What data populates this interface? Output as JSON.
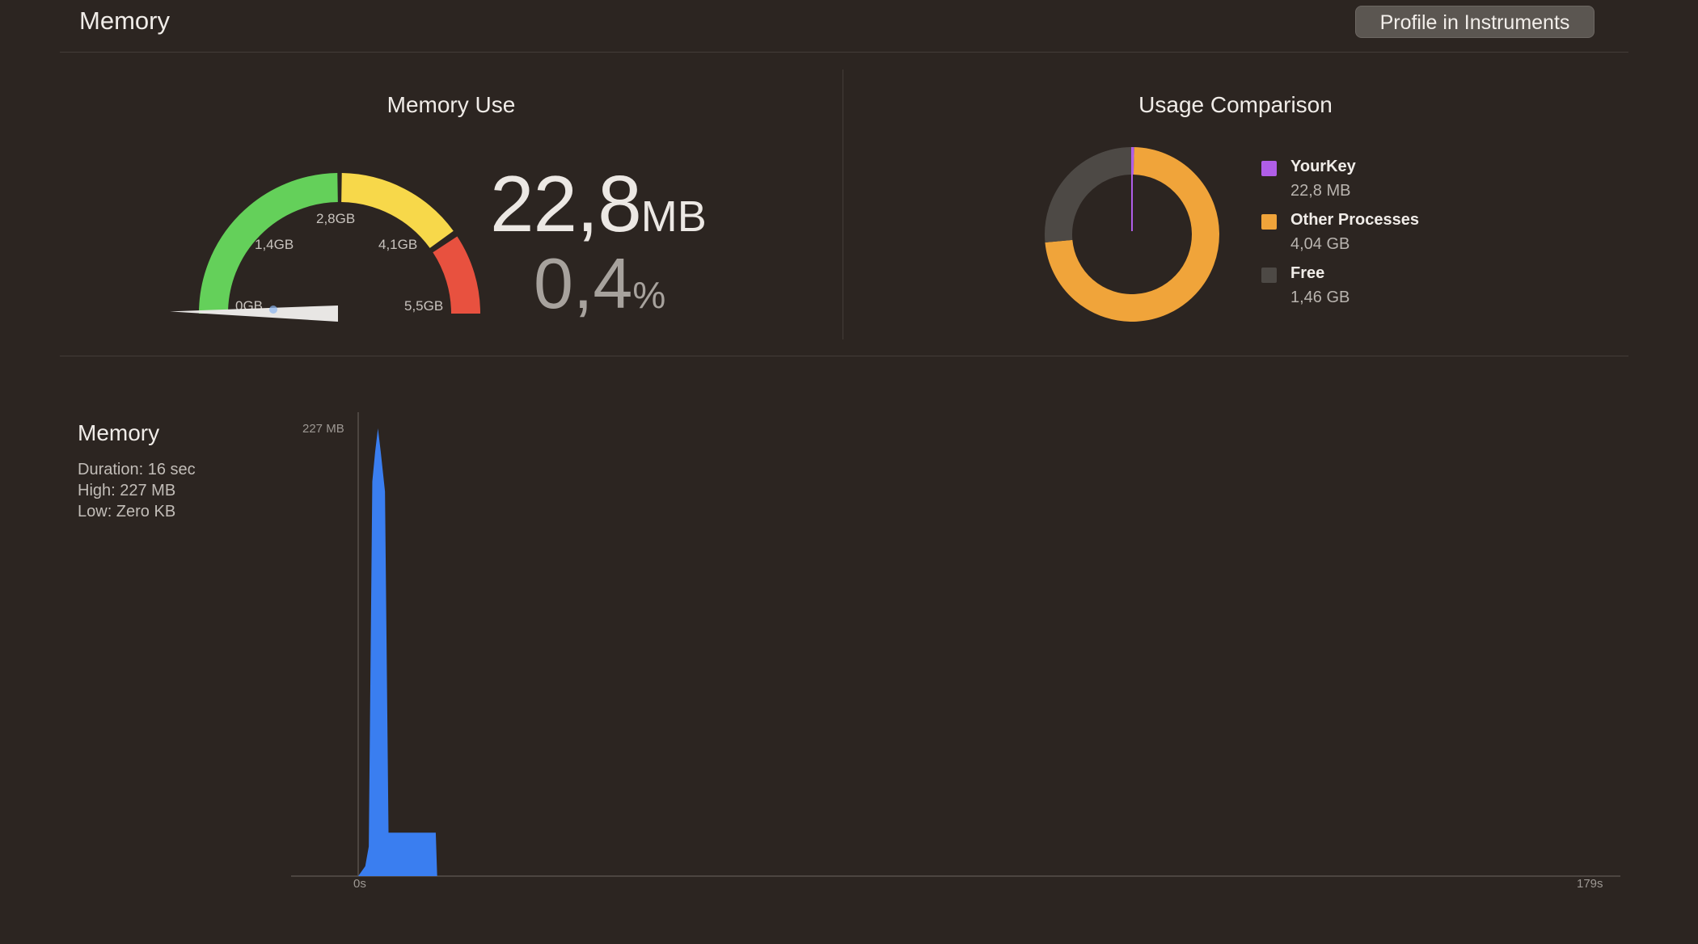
{
  "header": {
    "title": "Memory",
    "profile_button_label": "Profile in Instruments"
  },
  "memory_use": {
    "title": "Memory Use",
    "value": "22,8",
    "unit": "MB",
    "percent_value": "0,4",
    "percent_unit": "%",
    "gauge": {
      "tick_labels": [
        "0GB",
        "1,4GB",
        "2,8GB",
        "4,1GB",
        "5,5GB"
      ],
      "segments": [
        {
          "name": "green",
          "color": "#64d05a"
        },
        {
          "name": "yellow",
          "color": "#f7d84a"
        },
        {
          "name": "red",
          "color": "#e8513f"
        }
      ],
      "needle_fraction": 0.004
    }
  },
  "usage_comparison": {
    "title": "Usage Comparison",
    "legend": [
      {
        "name": "YourKey",
        "value": "22,8 MB",
        "color": "#b05ee8"
      },
      {
        "name": "Other Processes",
        "value": "4,04 GB",
        "color": "#f0a43a"
      },
      {
        "name": "Free",
        "value": "1,46 GB",
        "color": "#4d4945"
      }
    ]
  },
  "memory_graph": {
    "title": "Memory",
    "duration": "Duration: 16 sec",
    "high": "High: 227 MB",
    "low": "Low: Zero KB"
  },
  "chart_data": {
    "type": "area",
    "y_max_label": "227 MB",
    "x_start_label": "0s",
    "x_end_label": "179s",
    "ylim": [
      0,
      227
    ],
    "xlim": [
      0,
      179
    ],
    "color": "#3a7ef0",
    "x": [
      0,
      1,
      1.5,
      2,
      2.4,
      2.8,
      3.2,
      3.8,
      4.3,
      5,
      9,
      11,
      11.2
    ],
    "y": [
      0,
      5,
      15,
      200,
      215,
      227,
      215,
      195,
      22,
      22,
      22,
      22,
      0
    ]
  }
}
